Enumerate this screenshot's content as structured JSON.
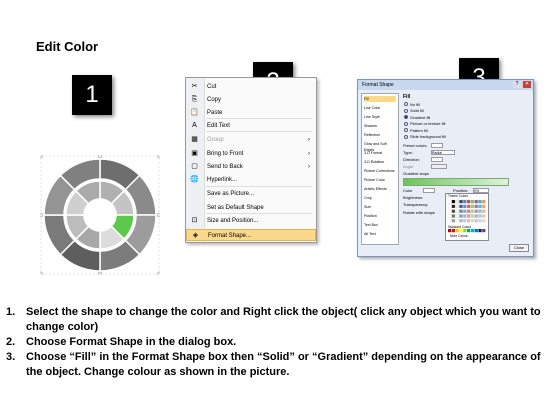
{
  "title": "Edit Color",
  "badges": [
    "1",
    "2",
    "3"
  ],
  "menu": {
    "items": [
      {
        "icon": "scissors-icon",
        "glyph": "✂",
        "label": "Cut",
        "underline": "t"
      },
      {
        "icon": "copy-icon",
        "glyph": "⎘",
        "label": "Copy"
      },
      {
        "icon": "paste-icon",
        "glyph": "📋",
        "label": "Paste"
      },
      {
        "icon": "edit-text-icon",
        "glyph": "A",
        "label": "Edit Text"
      },
      {
        "icon": "group-icon",
        "glyph": "▦",
        "label": "Group",
        "disabled": true,
        "arrow": "›"
      },
      {
        "icon": "bring-front-icon",
        "glyph": "▣",
        "label": "Bring to Front",
        "arrow": "›"
      },
      {
        "icon": "send-back-icon",
        "glyph": "▢",
        "label": "Send to Back",
        "arrow": "›"
      },
      {
        "icon": "hyperlink-icon",
        "glyph": "🌐",
        "label": "Hyperlink..."
      },
      {
        "icon": "",
        "glyph": "",
        "label": "Save as Picture..."
      },
      {
        "icon": "",
        "glyph": "",
        "label": "Set as Default Shape"
      },
      {
        "icon": "size-position-icon",
        "glyph": "⊡",
        "label": "Size and Position..."
      },
      {
        "icon": "format-shape-icon",
        "glyph": "◈",
        "label": "Format Shape...",
        "selected": true
      }
    ]
  },
  "dialog": {
    "title": "Format Shape",
    "nav": [
      "Fill",
      "Line Color",
      "Line Style",
      "Shadow",
      "Reflection",
      "Glow and Soft Edges",
      "3-D Format",
      "3-D Rotation",
      "Picture Corrections",
      "Picture Color",
      "Artistic Effects",
      "Crop",
      "Size",
      "Position",
      "Text Box",
      "Alt Text"
    ],
    "fill_header": "Fill",
    "options": [
      "No fill",
      "Solid fill",
      "Gradient fill",
      "Picture or texture fill",
      "Pattern fill",
      "Slide background fill"
    ],
    "preset_label": "Preset colors:",
    "type_label": "Type:",
    "type_value": "Radial",
    "direction_label": "Direction:",
    "angle_label": "Angle:",
    "stops_label": "Gradient stops",
    "color_label": "Color",
    "position_label": "Position:",
    "position_value": "0%",
    "brightness_label": "Brightness:",
    "transparency_label": "Transparency:",
    "rotate_label": "Rotate with shape",
    "theme_colors": "Theme Colors",
    "standard_colors": "Standard Colors",
    "more_colors": "More Colors...",
    "close": "Close"
  },
  "instructions": [
    {
      "n": "1.",
      "text": "Select the shape to change the color and Right click the object( click any object which you want to change color)"
    },
    {
      "n": "2.",
      "text": "Choose Format Shape in the dialog box."
    },
    {
      "n": "3.",
      "text": "Choose “Fill” in the Format Shape box then “Solid” or “Gradient” depending on the appearance of the object. Change colour as shown in the picture."
    }
  ],
  "colors": {
    "accent_green": "#5cc94a",
    "ring_gray": "#8c8c8c",
    "menu_highlight": "#fbd98a"
  }
}
